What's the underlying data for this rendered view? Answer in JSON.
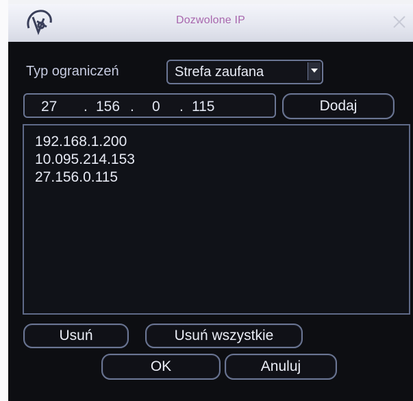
{
  "dialog": {
    "title": "Dozwolone IP",
    "icons": {
      "app": "dahua-logo-icon",
      "close": "close-icon"
    }
  },
  "restriction": {
    "label": "Typ ograniczeń",
    "selected": "Strefa zaufana"
  },
  "ip_input": {
    "octets": [
      "27",
      "156",
      "0",
      "115"
    ],
    "separator": "."
  },
  "buttons": {
    "add": "Dodaj",
    "remove": "Usuń",
    "remove_all": "Usuń wszystkie",
    "ok": "OK",
    "cancel": "Anuluj"
  },
  "ip_list": [
    "192.168.1.200",
    "10.095.214.153",
    "27.156.0.115"
  ],
  "colors": {
    "title_text": "#a866ad",
    "window_bg": "#0d0e12",
    "border": "#6b7694",
    "label_text": "#c6cbe0"
  }
}
